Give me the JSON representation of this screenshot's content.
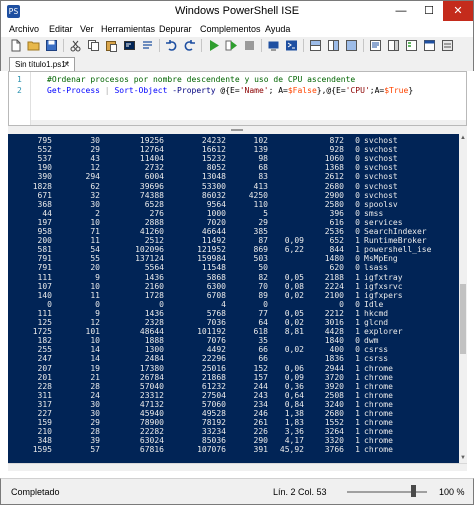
{
  "window": {
    "title": "Windows PowerShell ISE",
    "app_icon": "PS"
  },
  "window_controls": {
    "minimize": "—",
    "maximize": "☐",
    "close": "✕"
  },
  "menu": [
    "Archivo",
    "Editar",
    "Ver",
    "Herramientas",
    "Depurar",
    "Complementos",
    "Ayuda"
  ],
  "toolbar_icons": [
    "new-file-icon",
    "open-folder-icon",
    "save-icon",
    "cut-icon",
    "copy-icon",
    "paste-icon",
    "clear-console-icon",
    "undo-icon",
    "redo-icon",
    "run-script-icon",
    "run-selection-icon",
    "stop-icon",
    "remote-powershell-icon",
    "powershell-console-icon",
    "pane-layout-top-icon",
    "pane-layout-right-icon",
    "pane-layout-max-icon",
    "show-script-pane-icon",
    "show-command-pane-icon"
  ],
  "tab": {
    "label": "Sin título1.ps1*",
    "close": "✕"
  },
  "editor": {
    "lines": [
      {
        "number": "1",
        "segments": [
          {
            "t": "#Ordenar procesos por nombre descendente y uso de CPU ascendente",
            "c": "comment"
          }
        ]
      },
      {
        "number": "2",
        "segments": [
          {
            "t": "Get-Process",
            "c": "cmd"
          },
          {
            "t": " | ",
            "c": "op"
          },
          {
            "t": "Sort-Object",
            "c": "cmd"
          },
          {
            "t": " -Property",
            "c": "param"
          },
          {
            "t": " @{E=",
            "c": "plain"
          },
          {
            "t": "'Name'",
            "c": "str"
          },
          {
            "t": "; A=",
            "c": "plain"
          },
          {
            "t": "$False",
            "c": "var"
          },
          {
            "t": "},@{E=",
            "c": "plain"
          },
          {
            "t": "'CPU'",
            "c": "str"
          },
          {
            "t": ";A=",
            "c": "plain"
          },
          {
            "t": "$True",
            "c": "var"
          },
          {
            "t": "}",
            "c": "plain"
          }
        ]
      }
    ]
  },
  "console": {
    "rows": [
      [
        "795",
        "30",
        "19256",
        "24232",
        "102",
        "",
        "872",
        "0",
        "svchost"
      ],
      [
        "552",
        "29",
        "12764",
        "16612",
        "139",
        "",
        "928",
        "0",
        "svchost"
      ],
      [
        "537",
        "43",
        "11404",
        "15232",
        "98",
        "",
        "1060",
        "0",
        "svchost"
      ],
      [
        "190",
        "12",
        "2732",
        "8052",
        "68",
        "",
        "1368",
        "0",
        "svchost"
      ],
      [
        "390",
        "294",
        "6004",
        "13048",
        "83",
        "",
        "2612",
        "0",
        "svchost"
      ],
      [
        "1828",
        "62",
        "39696",
        "53300",
        "413",
        "",
        "2680",
        "0",
        "svchost"
      ],
      [
        "671",
        "32",
        "74388",
        "86032",
        "4250",
        "",
        "2900",
        "0",
        "svchost"
      ],
      [
        "368",
        "30",
        "6528",
        "9564",
        "110",
        "",
        "2580",
        "0",
        "spoolsv"
      ],
      [
        "44",
        "2",
        "276",
        "1000",
        "5",
        "",
        "396",
        "0",
        "smss"
      ],
      [
        "197",
        "10",
        "2888",
        "7020",
        "29",
        "",
        "616",
        "0",
        "services"
      ],
      [
        "958",
        "71",
        "41260",
        "46644",
        "385",
        "",
        "2536",
        "0",
        "SearchIndexer"
      ],
      [
        "200",
        "11",
        "2512",
        "11492",
        "87",
        "0,09",
        "652",
        "1",
        "RuntimeBroker"
      ],
      [
        "581",
        "54",
        "102096",
        "121952",
        "869",
        "6,22",
        "844",
        "1",
        "powershell_ise"
      ],
      [
        "791",
        "55",
        "137124",
        "159984",
        "503",
        "",
        "1480",
        "0",
        "MsMpEng"
      ],
      [
        "791",
        "20",
        "5564",
        "11548",
        "50",
        "",
        "620",
        "0",
        "lsass"
      ],
      [
        "111",
        "9",
        "1436",
        "5868",
        "82",
        "0,05",
        "2188",
        "1",
        "igfxtray"
      ],
      [
        "107",
        "10",
        "2160",
        "6300",
        "70",
        "0,08",
        "2224",
        "1",
        "igfxsrvc"
      ],
      [
        "140",
        "11",
        "1728",
        "6708",
        "89",
        "0,02",
        "2100",
        "1",
        "igfxpers"
      ],
      [
        "0",
        "0",
        "0",
        "4",
        "0",
        "",
        "0",
        "0",
        "Idle"
      ],
      [
        "111",
        "9",
        "1436",
        "5768",
        "77",
        "0,05",
        "2212",
        "1",
        "hkcmd"
      ],
      [
        "125",
        "12",
        "2328",
        "7036",
        "64",
        "0,02",
        "3016",
        "1",
        "glcnd"
      ],
      [
        "1725",
        "101",
        "48644",
        "101192",
        "618",
        "8,81",
        "4428",
        "1",
        "explorer"
      ],
      [
        "182",
        "10",
        "1888",
        "7076",
        "35",
        "",
        "1840",
        "0",
        "dwm"
      ],
      [
        "255",
        "14",
        "1300",
        "4492",
        "66",
        "0,02",
        "400",
        "0",
        "csrss"
      ],
      [
        "247",
        "14",
        "2484",
        "22296",
        "66",
        "",
        "1836",
        "1",
        "csrss"
      ],
      [
        "207",
        "19",
        "17380",
        "25016",
        "152",
        "0,06",
        "2944",
        "1",
        "chrome"
      ],
      [
        "201",
        "21",
        "26784",
        "21868",
        "157",
        "0,09",
        "3720",
        "1",
        "chrome"
      ],
      [
        "228",
        "28",
        "57040",
        "61232",
        "244",
        "0,36",
        "3920",
        "1",
        "chrome"
      ],
      [
        "311",
        "24",
        "23312",
        "27504",
        "243",
        "0,64",
        "2508",
        "1",
        "chrome"
      ],
      [
        "317",
        "30",
        "47132",
        "57060",
        "234",
        "0,84",
        "3240",
        "1",
        "chrome"
      ],
      [
        "227",
        "30",
        "45940",
        "49528",
        "246",
        "1,38",
        "2680",
        "1",
        "chrome"
      ],
      [
        "159",
        "29",
        "78900",
        "78192",
        "261",
        "1,83",
        "1552",
        "1",
        "chrome"
      ],
      [
        "210",
        "28",
        "22282",
        "33234",
        "226",
        "3,36",
        "3264",
        "1",
        "chrome"
      ],
      [
        "348",
        "39",
        "63024",
        "85036",
        "290",
        "4,17",
        "3320",
        "1",
        "chrome"
      ],
      [
        "1595",
        "57",
        "67816",
        "107076",
        "391",
        "45,92",
        "3766",
        "1",
        "chrome"
      ]
    ]
  },
  "status": {
    "left": "Completado",
    "position": "Lín. 2  Col. 53",
    "zoom": "100 %",
    "zoom_level_percent": 100
  }
}
